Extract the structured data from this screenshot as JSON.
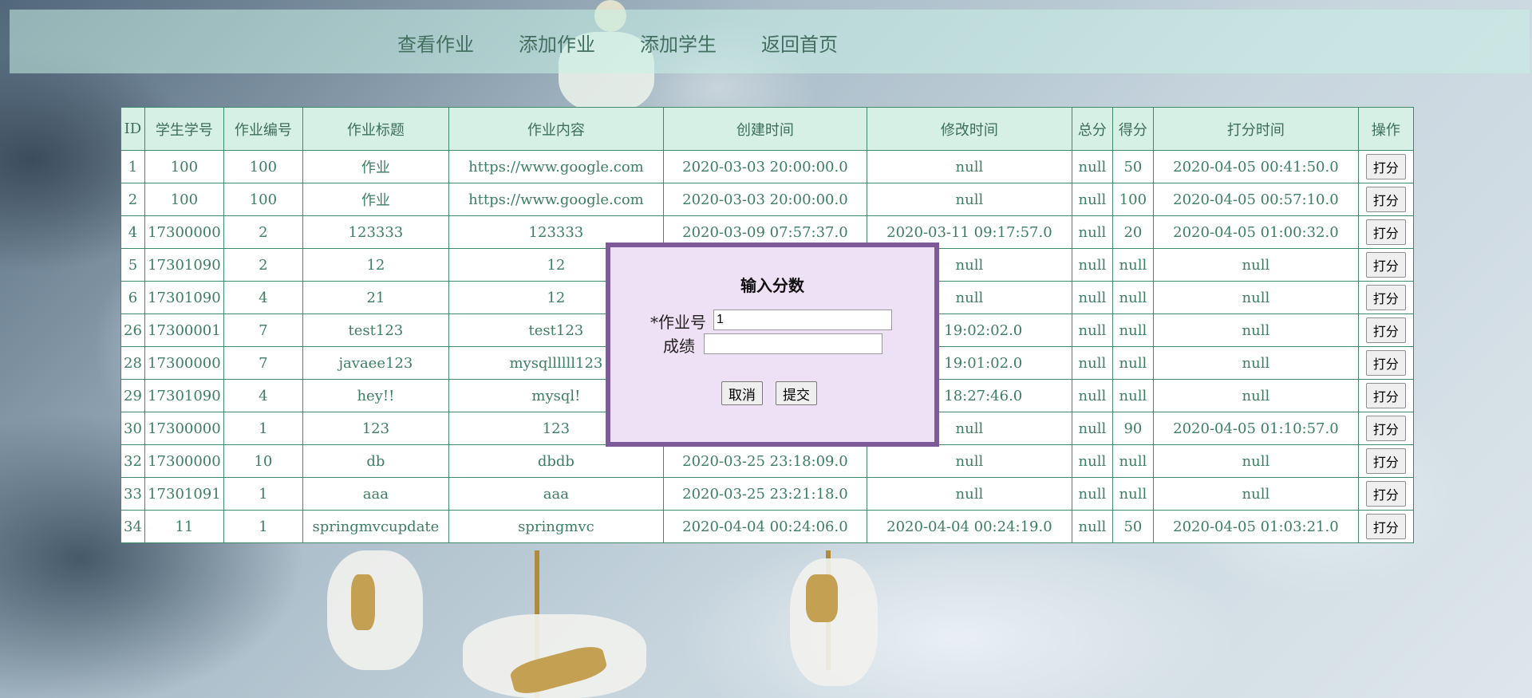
{
  "nav": {
    "items": [
      "查看作业",
      "添加作业",
      "添加学生",
      "返回首页"
    ]
  },
  "table": {
    "headers": [
      "ID",
      "学生学号",
      "作业编号",
      "作业标题",
      "作业内容",
      "创建时间",
      "修改时间",
      "总分",
      "得分",
      "打分时间",
      "操作"
    ],
    "action_label": "打分",
    "rows": [
      [
        "1",
        "100",
        "100",
        "作业",
        "https://www.google.com",
        "2020-03-03 20:00:00.0",
        "null",
        "null",
        "50",
        "2020-04-05 00:41:50.0"
      ],
      [
        "2",
        "100",
        "100",
        "作业",
        "https://www.google.com",
        "2020-03-03 20:00:00.0",
        "null",
        "null",
        "100",
        "2020-04-05 00:57:10.0"
      ],
      [
        "4",
        "17300000",
        "2",
        "123333",
        "123333",
        "2020-03-09 07:57:37.0",
        "2020-03-11 09:17:57.0",
        "null",
        "20",
        "2020-04-05 01:00:32.0"
      ],
      [
        "5",
        "17301090",
        "2",
        "12",
        "12",
        "",
        "null",
        "null",
        "null",
        "null"
      ],
      [
        "6",
        "17301090",
        "4",
        "21",
        "12",
        "",
        "null",
        "null",
        "null",
        "null"
      ],
      [
        "26",
        "17300001",
        "7",
        "test123",
        "test123",
        "",
        "-11 19:02:02.0",
        "null",
        "null",
        "null"
      ],
      [
        "28",
        "17300000",
        "7",
        "javaee123",
        "mysqllllll123",
        "",
        "-11 19:01:02.0",
        "null",
        "null",
        "null"
      ],
      [
        "29",
        "17301090",
        "4",
        "hey!!",
        "mysql!",
        "",
        "-11 18:27:46.0",
        "null",
        "null",
        "null"
      ],
      [
        "30",
        "17300000",
        "1",
        "123",
        "123",
        "",
        "null",
        "null",
        "90",
        "2020-04-05 01:10:57.0"
      ],
      [
        "32",
        "17300000",
        "10",
        "db",
        "dbdb",
        "2020-03-25 23:18:09.0",
        "null",
        "null",
        "null",
        "null"
      ],
      [
        "33",
        "17301091",
        "1",
        "aaa",
        "aaa",
        "2020-03-25 23:21:18.0",
        "null",
        "null",
        "null",
        "null"
      ],
      [
        "34",
        "11",
        "1",
        "springmvcupdate",
        "springmvc",
        "2020-04-04 00:24:06.0",
        "2020-04-04 00:24:19.0",
        "null",
        "50",
        "2020-04-05 01:03:21.0"
      ]
    ]
  },
  "modal": {
    "title": "输入分数",
    "homework_id_label": "*作业号",
    "homework_id_value": "1",
    "score_label": "成绩",
    "score_value": "",
    "cancel_label": "取消",
    "submit_label": "提交"
  },
  "colors": {
    "table_text": "#3d7e64",
    "table_border": "#3e8a6a",
    "header_bg": "#d6f0e6",
    "modal_bg": "#efe1f5",
    "modal_border": "#7d5a98"
  }
}
